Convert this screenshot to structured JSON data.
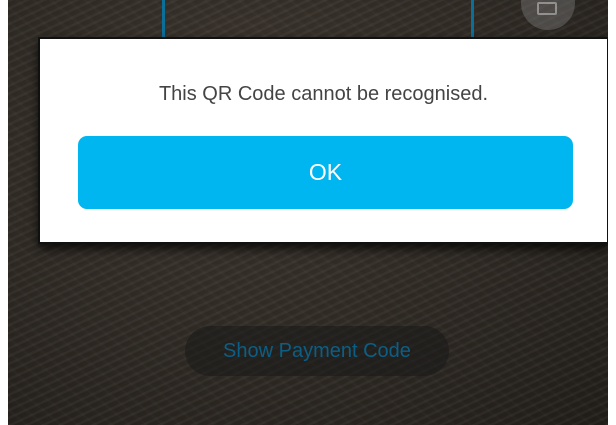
{
  "dialog": {
    "message": "This QR Code cannot be recognised.",
    "ok_label": "OK"
  },
  "scanner": {
    "show_payment_code_label": "Show Payment Code"
  },
  "colors": {
    "accent": "#00b6f1",
    "scan_frame": "#0c6f99",
    "overlay_text": "#0b5f86"
  },
  "icons": {
    "gallery": "image-icon"
  }
}
